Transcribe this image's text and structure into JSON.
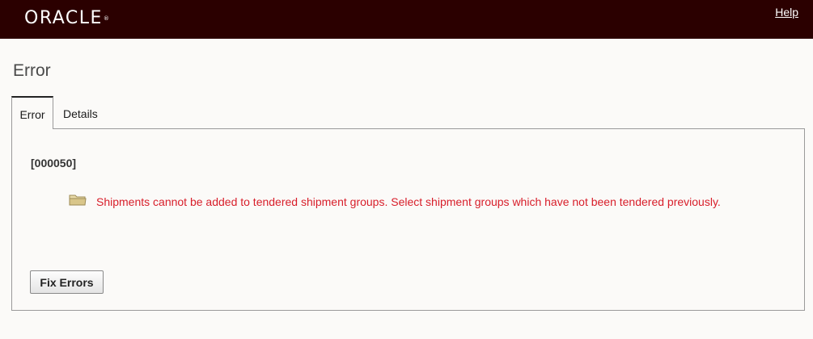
{
  "header": {
    "logo_text": "ORACLE",
    "logo_mark": "®",
    "help_label": "Help",
    "background_color": "#2b0000"
  },
  "page": {
    "title": "Error"
  },
  "tabs": [
    {
      "label": "Error",
      "selected": true
    },
    {
      "label": "Details",
      "selected": false
    }
  ],
  "error": {
    "code": "[000050]",
    "icon": "folder-icon",
    "message": "Shipments cannot be added to tendered shipment groups. Select shipment groups which have not been tendered previously.",
    "message_color": "#d81e2a"
  },
  "actions": {
    "fix_errors_label": "Fix Errors"
  }
}
